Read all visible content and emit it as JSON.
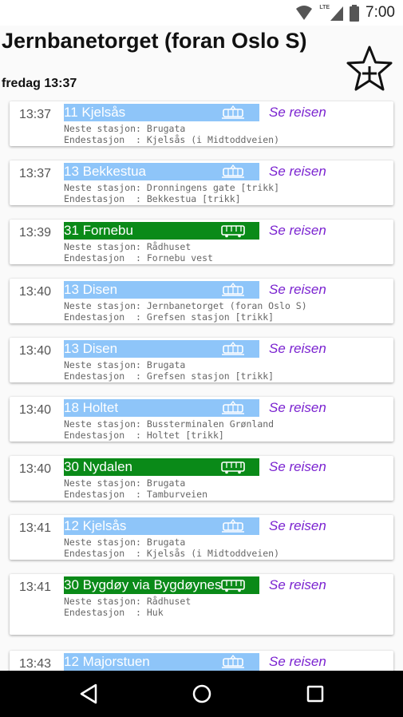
{
  "status_bar": {
    "time": "7:00",
    "network": "LTE"
  },
  "header": {
    "title": "Jernbanetorget (foran Oslo S)",
    "date_time": "fredag 13:37"
  },
  "labels": {
    "next_stop": "Neste stasjon: ",
    "final_stop": "Endestasjon  : ",
    "se_reisen": "Se reisen"
  },
  "departures": [
    {
      "time": "13:37",
      "line": "11 Kjelsås",
      "mode": "tram",
      "next": "Brugata",
      "final": "Kjelsås (i Midtoddveien)"
    },
    {
      "time": "13:37",
      "line": "13 Bekkestua",
      "mode": "tram",
      "next": "Dronningens gate [trikk]",
      "final": "Bekkestua [trikk]"
    },
    {
      "time": "13:39",
      "line": "31 Fornebu",
      "mode": "bus",
      "next": "Rådhuset",
      "final": "Fornebu vest"
    },
    {
      "time": "13:40",
      "line": "13 Disen",
      "mode": "tram",
      "next": "Jernbanetorget (foran Oslo S)",
      "final": "Grefsen stasjon [trikk]"
    },
    {
      "time": "13:40",
      "line": "13 Disen",
      "mode": "tram",
      "next": "Brugata",
      "final": "Grefsen stasjon [trikk]"
    },
    {
      "time": "13:40",
      "line": "18 Holtet",
      "mode": "tram",
      "next": "Bussterminalen Grønland",
      "final": "Holtet [trikk]"
    },
    {
      "time": "13:40",
      "line": "30 Nydalen",
      "mode": "bus",
      "next": "Brugata",
      "final": "Tamburveien"
    },
    {
      "time": "13:41",
      "line": "12 Kjelsås",
      "mode": "tram",
      "next": "Brugata",
      "final": "Kjelsås (i Midtoddveien)"
    },
    {
      "time": "13:41",
      "line": "30 Bygdøy via Bygdøynes",
      "mode": "bus",
      "next": "Rådhuset",
      "final": "Huk"
    },
    {
      "time": "13:43",
      "line": "12 Majorstuen",
      "mode": "tram",
      "next": "",
      "final": ""
    }
  ],
  "colors": {
    "tram": "#8ec5f9",
    "bus": "#0a8a18",
    "link": "#7a22d0"
  },
  "icons": [
    "signal-icon",
    "lte-icon",
    "battery-icon",
    "star-plus-icon",
    "tram-icon",
    "bus-icon",
    "back-icon",
    "home-icon",
    "recents-icon"
  ]
}
